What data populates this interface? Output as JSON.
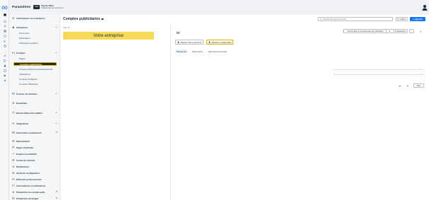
{
  "app": {
    "title": "Paramètres"
  },
  "business": {
    "name": "Top Dri Mén",
    "subtitle": "Portefeuille de connexion"
  },
  "sidebar": {
    "items": [
      {
        "label": "Informations sur l'entreprise",
        "icon": "settings-icon"
      },
      {
        "label": "Utilisateurs",
        "icon": "user-icon"
      },
      {
        "label": "Comptes",
        "icon": "folder-icon"
      },
      {
        "label": "Sources de données",
        "icon": "data-icon"
      },
      {
        "label": "Demandes",
        "icon": "bell-icon"
      },
      {
        "label": "Brand safety and suitabil...",
        "icon": "shield-icon"
      },
      {
        "label": "Intégrations",
        "icon": "plug-icon"
      },
      {
        "label": "Facturation et paiements",
        "icon": "card-icon"
      },
      {
        "label": "Meta Verified",
        "icon": "verified-icon"
      },
      {
        "label": "Pages d'activités",
        "icon": "page-icon"
      },
      {
        "label": "Espace Co-publicité",
        "icon": "handshake-icon"
      },
      {
        "label": "Centre de sécurité",
        "icon": "lock-icon"
      },
      {
        "label": "Notifications",
        "icon": "bell-icon"
      },
      {
        "label": "Guide de configuration",
        "icon": "list-icon"
      },
      {
        "label": "Éléments professionnels",
        "icon": "briefcase-icon"
      },
      {
        "label": "Autorisations et vérifications",
        "icon": "check-icon"
      },
      {
        "label": "Paramètres du compte publ...",
        "icon": "gear-icon"
      },
      {
        "label": "Paramètres de langue",
        "icon": "globe-icon"
      }
    ],
    "users_sub": [
      "Personnes",
      "Partenaires",
      "Utilisateurs système"
    ],
    "accounts_sub": [
      "Pages",
      "Comptes publicitaires",
      "Groupes d'éléments professionnels",
      "Applications",
      "Comptes Instagram",
      "Comptes WhatsApp"
    ]
  },
  "main": {
    "title": "Comptes publicitaires",
    "search_placeholder": "Rechercher par nom ou ID",
    "filter_label": "Filtres",
    "add_label": "Ajouter",
    "column_header": "Nom",
    "rows": [
      "Votre entreprise"
    ]
  },
  "detail": {
    "open_manager_label": "Ouvrir dans le Gestionnaire de publicités",
    "disable_label": "Désactiver",
    "more_label": "···",
    "close_label": "×",
    "assign_people_label": "Affecter des personnes",
    "assign_partners_label": "Affecter un partenaire",
    "tabs": [
      "Personnes",
      "Partenaires",
      "Éléments connectés"
    ],
    "next_label": "Next"
  }
}
